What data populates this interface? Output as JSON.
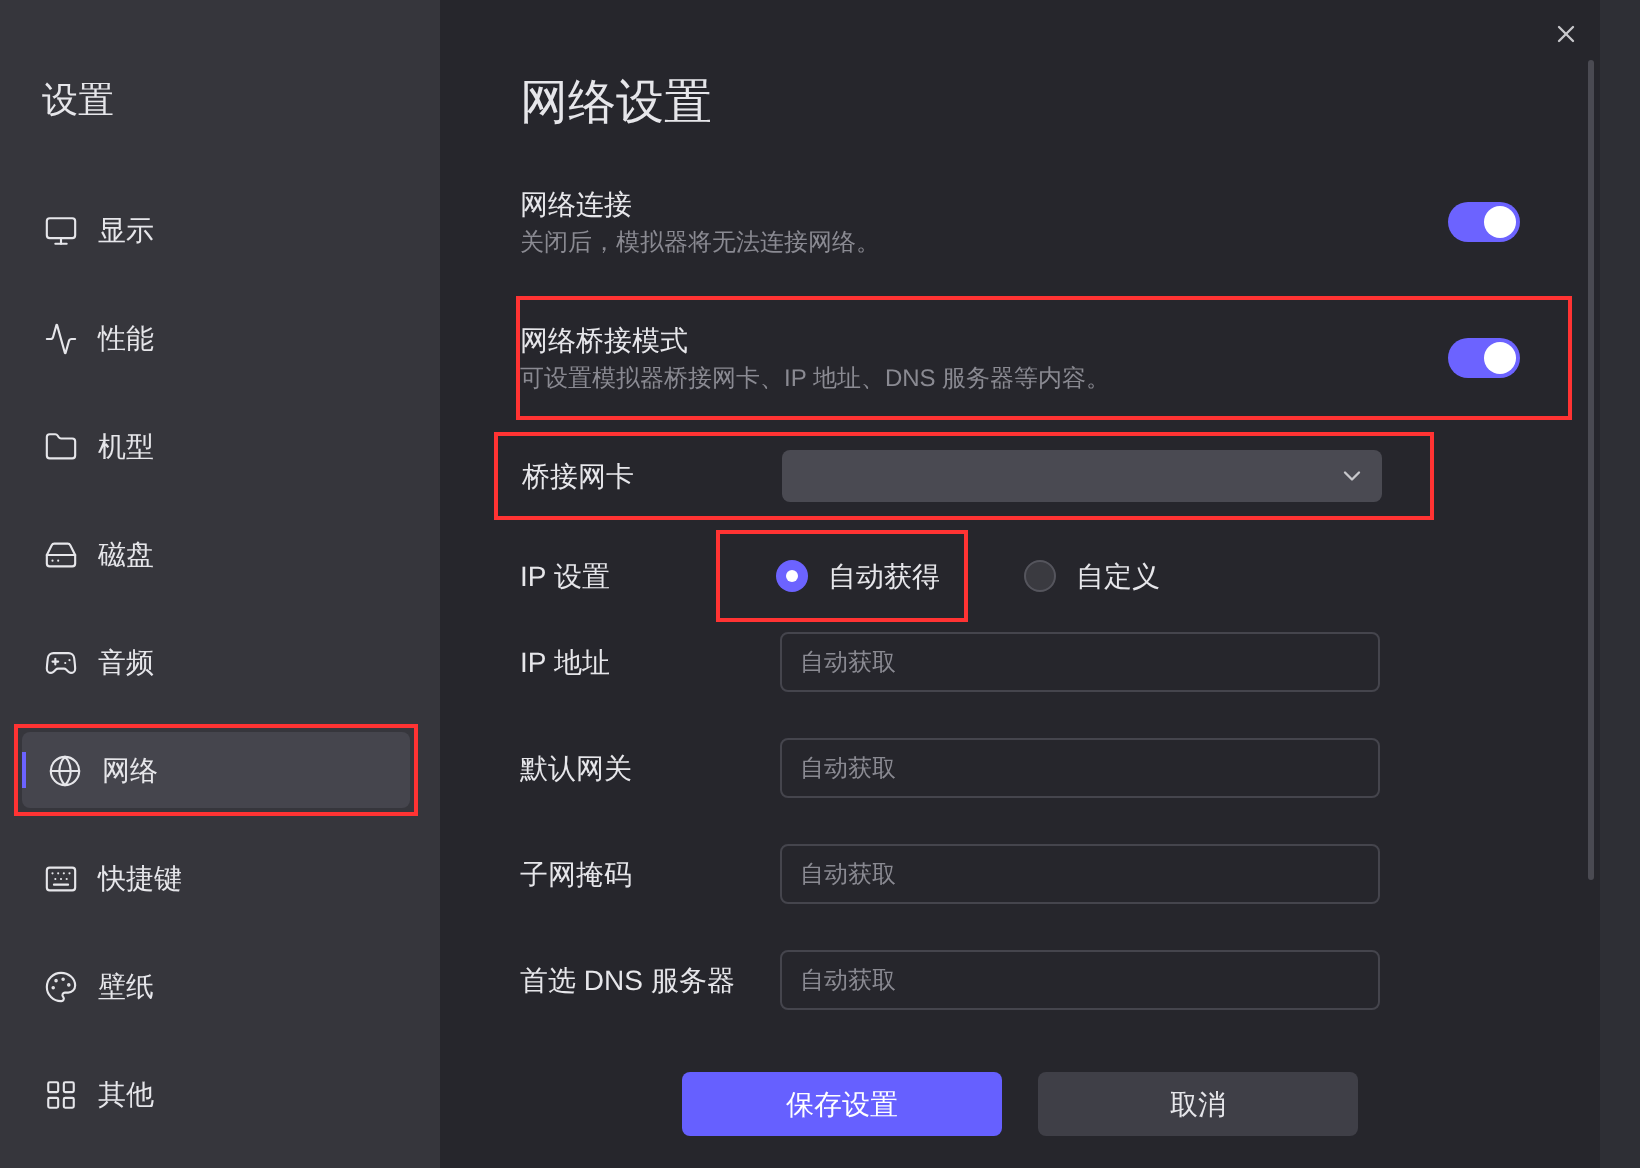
{
  "sidebar": {
    "title": "设置",
    "items": [
      {
        "label": "显示",
        "selected": false,
        "highlighted": false
      },
      {
        "label": "性能",
        "selected": false,
        "highlighted": false
      },
      {
        "label": "机型",
        "selected": false,
        "highlighted": false
      },
      {
        "label": "磁盘",
        "selected": false,
        "highlighted": false
      },
      {
        "label": "音频",
        "selected": false,
        "highlighted": false
      },
      {
        "label": "网络",
        "selected": true,
        "highlighted": true
      },
      {
        "label": "快捷键",
        "selected": false,
        "highlighted": false
      },
      {
        "label": "壁纸",
        "selected": false,
        "highlighted": false
      },
      {
        "label": "其他",
        "selected": false,
        "highlighted": false
      }
    ]
  },
  "page": {
    "title": "网络设置",
    "toggles": [
      {
        "label": "网络连接",
        "description": "关闭后，模拟器将无法连接网络。",
        "on": true,
        "highlighted": false
      },
      {
        "label": "网络桥接模式",
        "description": "可设置模拟器桥接网卡、IP 地址、DNS 服务器等内容。",
        "on": true,
        "highlighted": true
      }
    ],
    "adapter": {
      "label": "桥接网卡",
      "highlighted": true
    },
    "ip_setting": {
      "label": "IP 设置",
      "options": [
        {
          "label": "自动获得",
          "selected": true,
          "highlighted": true
        },
        {
          "label": "自定义",
          "selected": false,
          "highlighted": false
        }
      ]
    },
    "fields": [
      {
        "label": "IP 地址",
        "placeholder": "自动获取"
      },
      {
        "label": "默认网关",
        "placeholder": "自动获取"
      },
      {
        "label": "子网掩码",
        "placeholder": "自动获取"
      },
      {
        "label": "首选 DNS 服务器",
        "placeholder": "自动获取"
      }
    ],
    "buttons": [
      {
        "label": "保存设置",
        "kind": "primary"
      },
      {
        "label": "取消",
        "kind": "secondary"
      }
    ]
  }
}
